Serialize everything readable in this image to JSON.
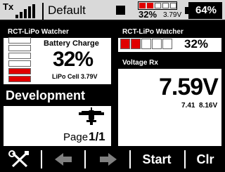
{
  "statusbar": {
    "tx_label": "Tx",
    "model_name": "Default",
    "rx_battery_pct": "32%",
    "rx_voltage": "3.79V",
    "tx_battery_pct": "64%"
  },
  "widgets": {
    "lipo_watcher_1": {
      "title": "RCT-LiPo Watcher",
      "label": "Battery Charge",
      "value": "32%",
      "cell_label": "LiPo Cell 3.79V",
      "filled_cells": 2,
      "total_cells": 6
    },
    "lipo_watcher_2": {
      "title": "RCT-LiPo Watcher",
      "value": "32%",
      "filled_cells": 2,
      "total_cells": 5
    },
    "voltage_rx": {
      "title": "Voltage Rx",
      "value": "7.59V",
      "min": "7.41",
      "max": "8.16V"
    },
    "development": {
      "title": "Development",
      "page_label": "Page",
      "page_value": "1/1",
      "icon": "airplane-icon"
    }
  },
  "toolbar": {
    "tools_icon": "wrench-screwdriver-icon",
    "prev_icon": "arrow-left-icon",
    "next_icon": "arrow-right-icon",
    "start_label": "Start",
    "clear_label": "Clr"
  },
  "colors": {
    "accent_red": "#e00000",
    "bar_gray": "#d9d9d9",
    "arrow_disabled": "#808080"
  }
}
